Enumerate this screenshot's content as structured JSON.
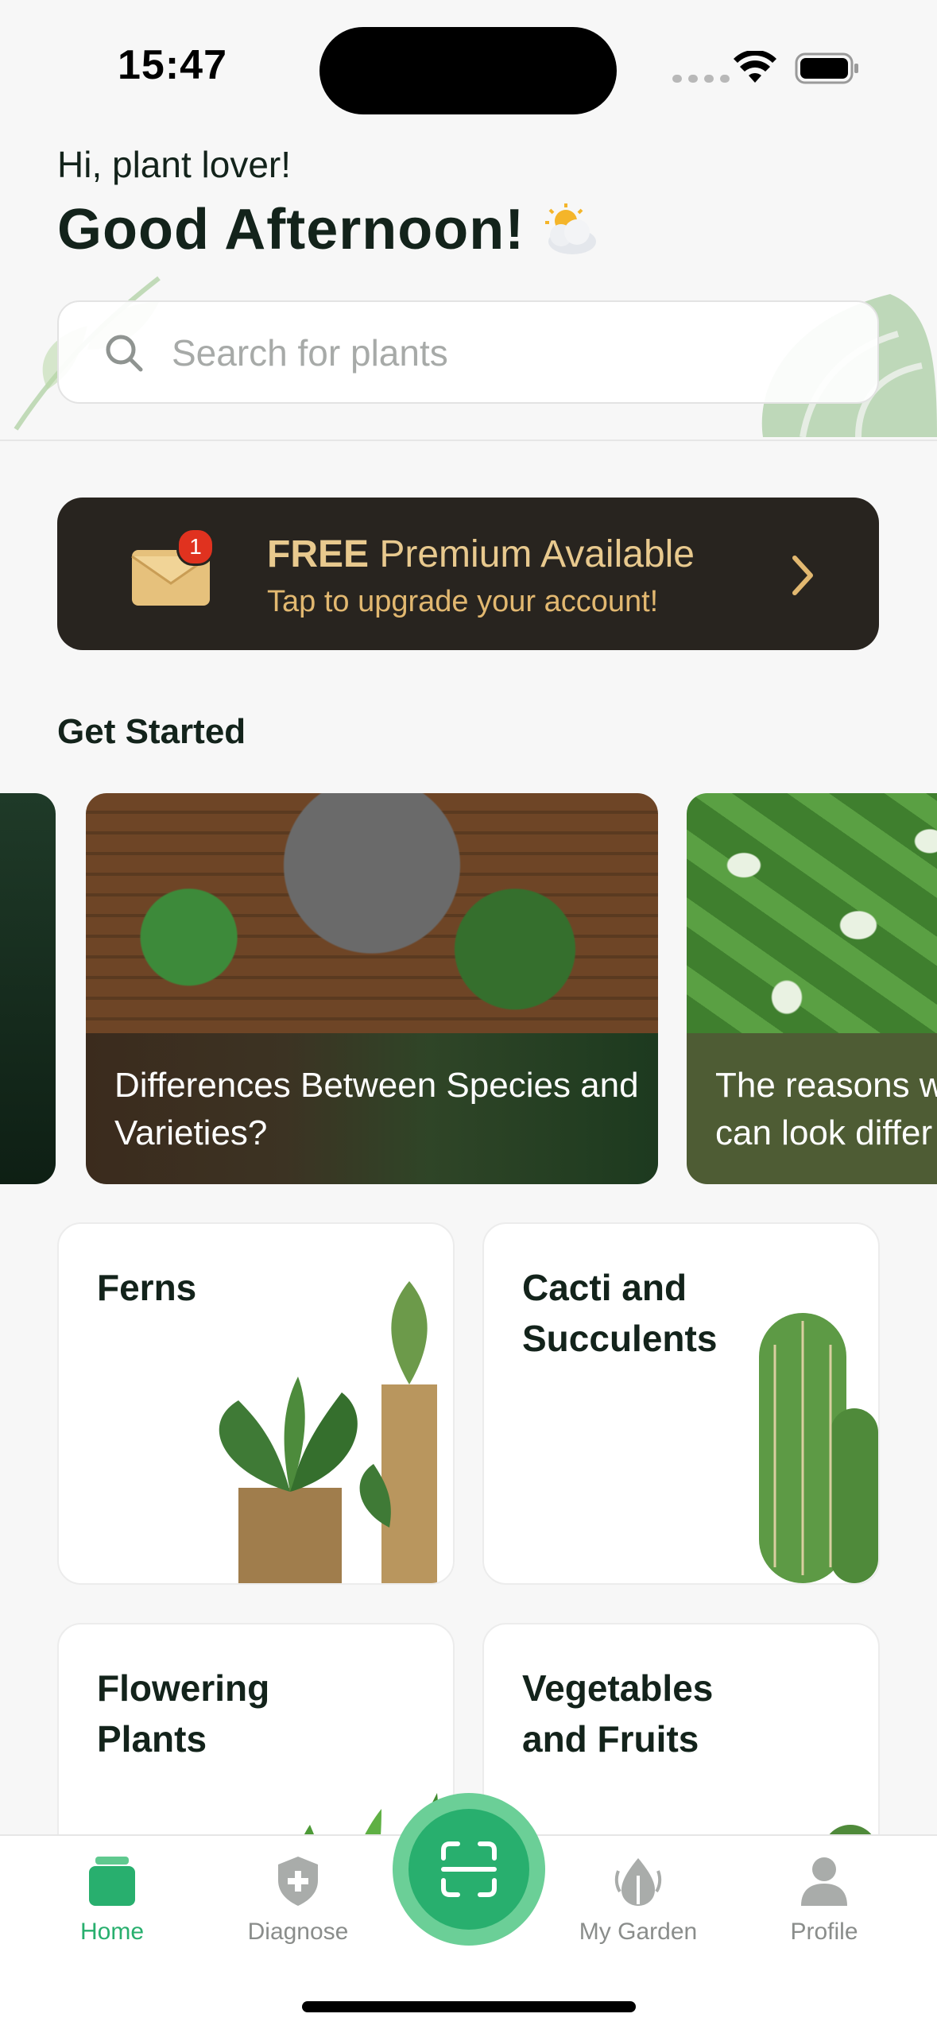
{
  "status_bar": {
    "time": "15:47"
  },
  "header": {
    "greeting": "Hi, plant lover!",
    "title": "Good Afternoon!",
    "weather_icon": "sun-cloud-icon"
  },
  "search": {
    "placeholder": "Search for plants",
    "value": ""
  },
  "premium": {
    "title_bold": "FREE",
    "title_rest": "Premium Available",
    "subtitle": "Tap to upgrade your account!",
    "badge_count": "1",
    "colors": {
      "background": "#28241f",
      "text": "#e8c98e",
      "badge": "#e0321f"
    }
  },
  "get_started": {
    "title": "Get Started",
    "cards": [
      {
        "title": "Differences Between Species and Varieties?"
      },
      {
        "title": "The reasons w can look differ"
      }
    ]
  },
  "categories": [
    {
      "label": "Ferns"
    },
    {
      "label": "Cacti and Succulents"
    },
    {
      "label": "Flowering Plants"
    },
    {
      "label": "Vegetables and Fruits"
    }
  ],
  "nav": {
    "items": [
      {
        "label": "Home",
        "icon": "home-icon",
        "active": true
      },
      {
        "label": "Diagnose",
        "icon": "shield-plus-icon",
        "active": false
      },
      {
        "label": "My Garden",
        "icon": "leaf-drop-icon",
        "active": false
      },
      {
        "label": "Profile",
        "icon": "person-icon",
        "active": false
      }
    ],
    "scan_icon": "scan-icon",
    "accent": "#28af6e"
  }
}
